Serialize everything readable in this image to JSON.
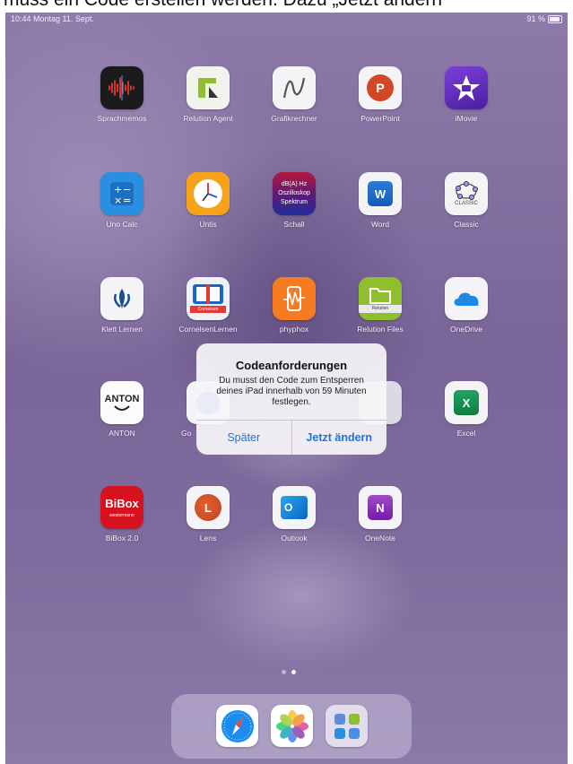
{
  "caption": "muss ein Code erstellen werden. Dazu „Jetzt ändern“",
  "status_bar": {
    "time_date": "10:44  Montag 11. Sept.",
    "battery": "91 %"
  },
  "apps": [
    {
      "label": "Sprachmemos",
      "icon": "voice-memos-icon"
    },
    {
      "label": "Relution Agent",
      "icon": "relution-agent-icon"
    },
    {
      "label": "Grafikrechner",
      "icon": "graphing-calculator-icon"
    },
    {
      "label": "PowerPoint",
      "icon": "powerpoint-icon",
      "glyph": "P"
    },
    {
      "label": "iMovie",
      "icon": "imovie-icon"
    },
    {
      "label": "Uno Calc",
      "icon": "calculator-icon"
    },
    {
      "label": "Untis",
      "icon": "clock-icon"
    },
    {
      "label": "Schall",
      "icon": "schall-icon",
      "glyph_lines": [
        "dB(A) Hz",
        "Oszilloskop",
        "Spektrum"
      ]
    },
    {
      "label": "Word",
      "icon": "word-icon",
      "glyph": "W"
    },
    {
      "label": "Classic",
      "icon": "geogebra-classic-icon",
      "glyph": "CLASSIC"
    },
    {
      "label": "Klett Lernen",
      "icon": "klett-icon"
    },
    {
      "label": "CornelsenLernen",
      "icon": "cornelsen-icon",
      "glyph": "Cornelsen"
    },
    {
      "label": "phyphox",
      "icon": "phyphox-icon"
    },
    {
      "label": "Relution Files",
      "icon": "relution-files-icon",
      "glyph": "Relution"
    },
    {
      "label": "OneDrive",
      "icon": "onedrive-icon"
    },
    {
      "label": "ANTON",
      "icon": "anton-icon",
      "glyph": "ANTON"
    },
    {
      "label": "Go",
      "icon": "google-icon"
    },
    {
      "label": "",
      "icon": "hidden-app-icon"
    },
    {
      "label": "",
      "icon": "hidden-app-icon"
    },
    {
      "label": "Excel",
      "icon": "excel-icon",
      "glyph": "X"
    },
    {
      "label": "BiBox 2.0",
      "icon": "bibox-icon",
      "glyph": "BiBox",
      "glyph_sub": "westermann"
    },
    {
      "label": "Lens",
      "icon": "office-lens-icon",
      "glyph": "L"
    },
    {
      "label": "Outlook",
      "icon": "outlook-icon",
      "glyph": "O"
    },
    {
      "label": "OneNote",
      "icon": "onenote-icon",
      "glyph": "N"
    }
  ],
  "alert": {
    "title": "Codeanforderungen",
    "message": "Du musst den Code zum Entsperren deines iPad innerhalb von 59 Minuten festlegen.",
    "cancel_label": "Später",
    "confirm_label": "Jetzt ändern"
  },
  "dock": [
    {
      "icon": "safari-icon"
    },
    {
      "icon": "photos-icon"
    },
    {
      "icon": "app-library-icon"
    }
  ]
}
